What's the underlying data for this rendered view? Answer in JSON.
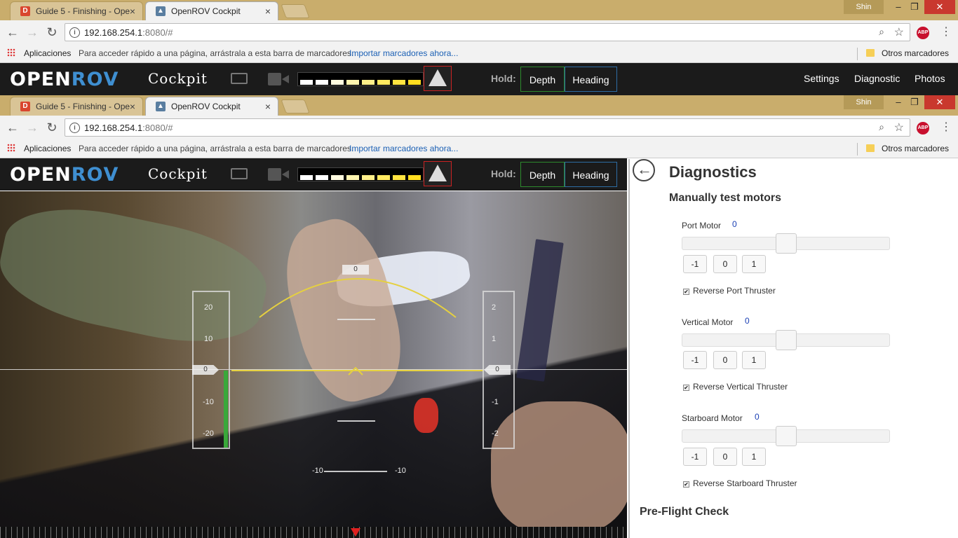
{
  "browser": {
    "tabs": [
      {
        "title": "Guide 5 - Finishing - Ope",
        "favicon": "D",
        "close": "×"
      },
      {
        "title": "OpenROV Cockpit",
        "close": "×"
      }
    ],
    "user": "Shin",
    "window_controls": {
      "minimize": "–",
      "maximize": "❐",
      "close": "✕"
    },
    "url_host": "192.168.254.1",
    "url_rest": ":8080/#",
    "nav": {
      "back": "←",
      "forward": "→",
      "reload": "↻"
    },
    "abp_label": "ABP",
    "bookmarks": {
      "apps": "Aplicaciones",
      "hint": "Para acceder rápido a una página, arrástrala a esta barra de marcadores.",
      "import": "Importar marcadores ahora...",
      "others": "Otros marcadores"
    }
  },
  "cockpit": {
    "logo_open": "OPEN",
    "logo_rov": "RОV",
    "title": "Cockpit",
    "hold_label": "Hold:",
    "hold_depth": "Depth",
    "hold_heading": "Heading",
    "nav": {
      "settings": "Settings",
      "diagnostic": "Diagnostic",
      "photos": "Photos"
    },
    "battery_colors": [
      "#ffffff",
      "#ffffff",
      "#fffbe0",
      "#fff5b0",
      "#ffef8a",
      "#ffe960",
      "#ffe340",
      "#ffdd20"
    ]
  },
  "hud": {
    "pitch_ticks": [
      "20",
      "10",
      "0",
      "-10",
      "-20"
    ],
    "depth_ticks": [
      "2",
      "1",
      "0",
      "-1",
      "-2"
    ],
    "pitch_value": "0",
    "depth_value": "0",
    "roll_value": "0",
    "roll_left": "-10",
    "roll_right": "-10"
  },
  "diagnostics": {
    "title": "Diagnostics",
    "subtitle": "Manually test motors",
    "motors": [
      {
        "name": "Port Motor",
        "value": "0",
        "reverse_label": "Reverse Port Thruster"
      },
      {
        "name": "Vertical Motor",
        "value": "0",
        "reverse_label": "Reverse Vertical Thruster"
      },
      {
        "name": "Starboard Motor",
        "value": "0",
        "reverse_label": "Reverse Starboard Thruster"
      }
    ],
    "buttons": [
      "-1",
      "0",
      "1"
    ],
    "checked": "✔",
    "preflight": "Pre-Flight Check"
  }
}
